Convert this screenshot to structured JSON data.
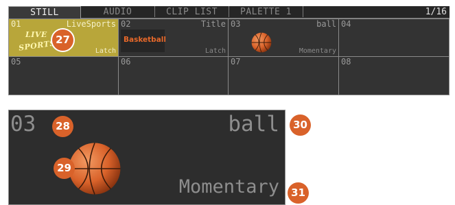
{
  "tabs": [
    {
      "label": "STILL",
      "active": true
    },
    {
      "label": "AUDIO",
      "active": false
    },
    {
      "label": "CLIP LIST",
      "active": false
    },
    {
      "label": "PALETTE 1",
      "active": false
    }
  ],
  "page_indicator": "1/16",
  "cells": [
    {
      "number": "01",
      "title": "LiveSports",
      "mode": "Latch",
      "thumbnail": "live-sports-logo",
      "selected": true,
      "thumb_text_1": "LIVE",
      "thumb_text_2": "SPORTS"
    },
    {
      "number": "02",
      "title": "Title",
      "mode": "Latch",
      "thumbnail": "basketball-text",
      "selected": false,
      "thumb_text": "Basketball"
    },
    {
      "number": "03",
      "title": "ball",
      "mode": "Momentary",
      "thumbnail": "basketball-image",
      "selected": false
    },
    {
      "number": "04",
      "title": "",
      "mode": "",
      "selected": false
    },
    {
      "number": "05",
      "title": "",
      "mode": "",
      "selected": false
    },
    {
      "number": "06",
      "title": "",
      "mode": "",
      "selected": false
    },
    {
      "number": "07",
      "title": "",
      "mode": "",
      "selected": false
    },
    {
      "number": "08",
      "title": "",
      "mode": "",
      "selected": false
    }
  ],
  "detail": {
    "number": "03",
    "title": "ball",
    "mode": "Momentary",
    "thumbnail": "basketball-image"
  },
  "callouts": [
    "27",
    "28",
    "29",
    "30",
    "31"
  ],
  "colors": {
    "selected_cell": "#b8a63a",
    "badge": "#d9622a",
    "panel_bg": "#2d2d2d",
    "basketball_text": "#e6682a"
  }
}
